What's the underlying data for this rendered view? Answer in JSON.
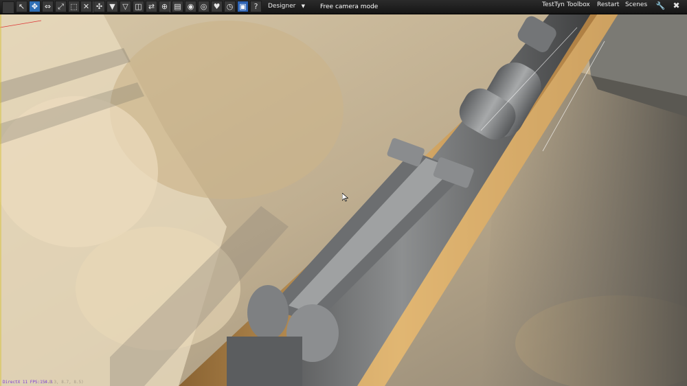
{
  "toolbar": {
    "tools": [
      {
        "icon": "pointer-icon",
        "glyph": "↖",
        "active": false
      },
      {
        "icon": "move-icon",
        "glyph": "✥",
        "active": true
      },
      {
        "icon": "resize-icon",
        "glyph": "⇔",
        "active": false
      },
      {
        "icon": "scale-icon",
        "glyph": "⤢",
        "active": false
      },
      {
        "icon": "crop-icon",
        "glyph": "⬚",
        "active": false
      },
      {
        "icon": "smiley-icon",
        "glyph": "☺",
        "active": false
      }
    ],
    "tools2": [
      {
        "icon": "scissors-icon",
        "glyph": "✕"
      },
      {
        "icon": "snap-icon",
        "glyph": "✣"
      },
      {
        "icon": "filter-solid-icon",
        "glyph": "▼"
      },
      {
        "icon": "filter-outline-icon",
        "glyph": "▽"
      },
      {
        "icon": "panel-icon",
        "glyph": "◫"
      },
      {
        "icon": "link-icon",
        "glyph": "⇄"
      },
      {
        "icon": "target-icon",
        "glyph": "⊕"
      }
    ],
    "tools3": [
      {
        "icon": "document-icon",
        "glyph": "▤"
      },
      {
        "icon": "eye-shaded-icon",
        "glyph": "◉"
      },
      {
        "icon": "eye-icon",
        "glyph": "◎"
      },
      {
        "icon": "heart-icon",
        "glyph": "♥"
      },
      {
        "icon": "stopwatch-icon",
        "glyph": "◷"
      },
      {
        "icon": "save-icon",
        "glyph": "▣"
      },
      {
        "icon": "help-icon",
        "glyph": "?"
      }
    ],
    "preset": "Designer",
    "mode_label": "Free camera mode",
    "menu": [
      "TestTyn",
      "Toolbox",
      "Restart",
      "Scenes"
    ]
  },
  "stats": {
    "api": "DirectX 11 FPS:154.3",
    "camera": "( 8.3, 8.7, 8.5)"
  },
  "colors": {
    "toolbar_active": "#2f6fb5",
    "stats_text": "#7d3fd6"
  }
}
